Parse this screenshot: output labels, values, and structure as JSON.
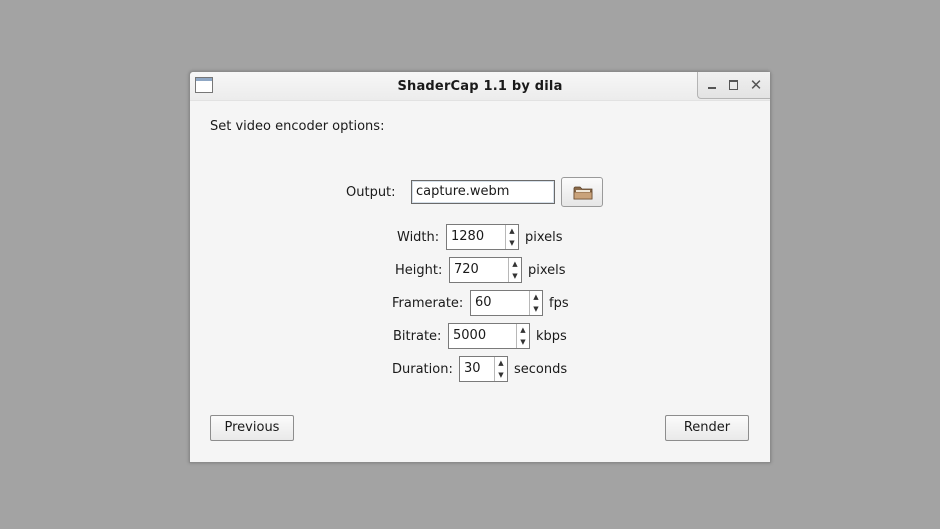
{
  "window": {
    "title": "ShaderCap 1.1 by dila"
  },
  "page": {
    "instruction": "Set video encoder options:"
  },
  "output": {
    "label": "Output:",
    "value": "capture.webm"
  },
  "fields": {
    "width": {
      "label": "Width:",
      "value": "1280",
      "unit": "pixels"
    },
    "height": {
      "label": "Height:",
      "value": "720",
      "unit": "pixels"
    },
    "framerate": {
      "label": "Framerate:",
      "value": "60",
      "unit": "fps"
    },
    "bitrate": {
      "label": "Bitrate:",
      "value": "5000",
      "unit": "kbps"
    },
    "duration": {
      "label": "Duration:",
      "value": "30",
      "unit": "seconds"
    }
  },
  "buttons": {
    "previous": "Previous",
    "render": "Render"
  },
  "icons": {
    "app": "window-icon",
    "minimize": "minimize-icon",
    "maximize": "maximize-icon",
    "close": "close-icon",
    "browse": "folder-icon",
    "up": "arrow-up-icon",
    "down": "arrow-down-icon"
  }
}
